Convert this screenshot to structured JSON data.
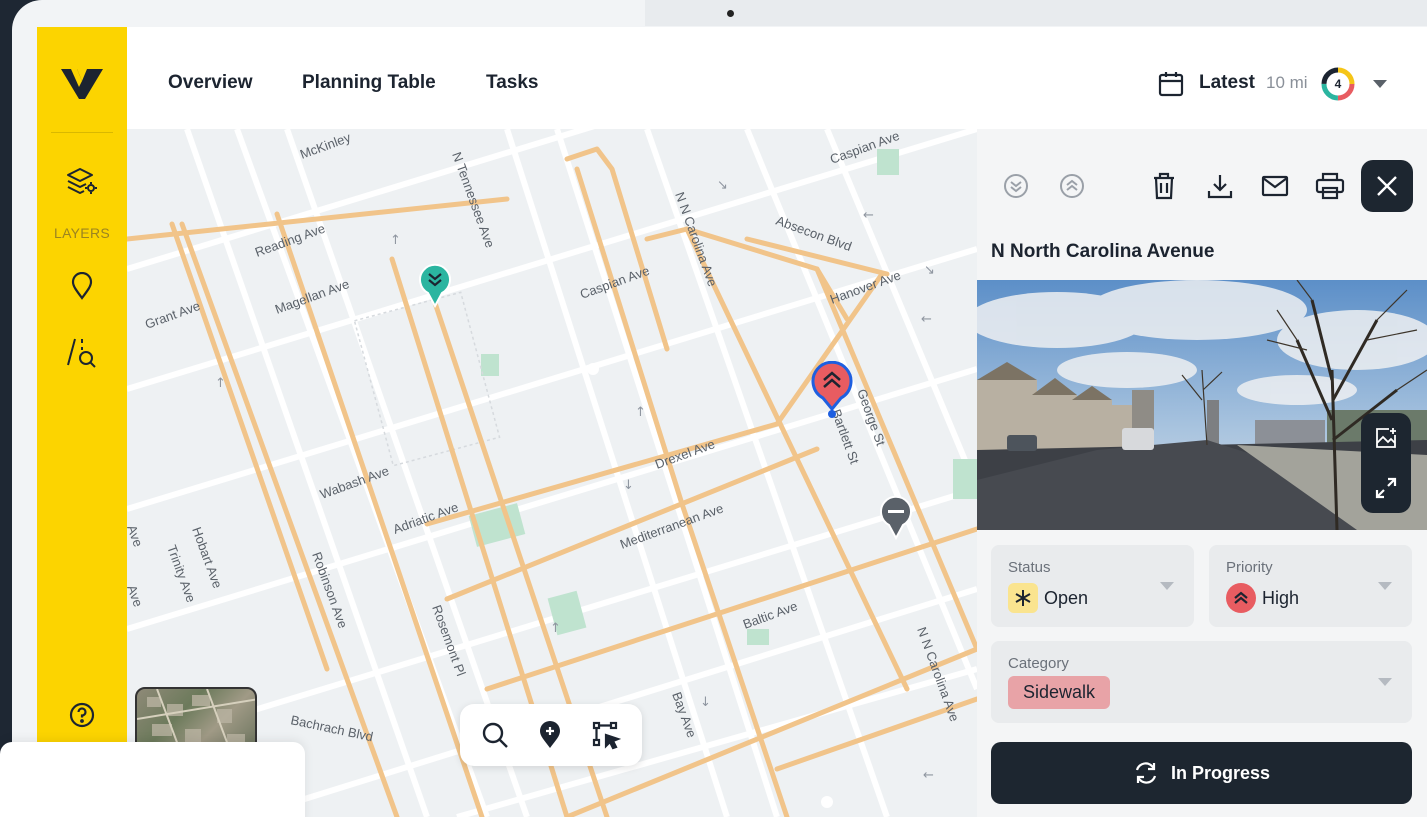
{
  "nav": {
    "tabs": [
      "Overview",
      "Planning Table",
      "Tasks"
    ],
    "date_filter": "Latest",
    "radius": "10 mi",
    "issue_count": "4"
  },
  "sidebar": {
    "layers_label": "LAYERS"
  },
  "map": {
    "street_labels": [
      "McKinley",
      "Reading Ave",
      "Magellan Ave",
      "Grant Ave",
      "N Tennessee Ave",
      "Caspian Ave",
      "Caspian Ave",
      "N N Carolina Ave",
      "Absecon Blvd",
      "Hanover Ave",
      "George St",
      "N Bartlett St",
      "Drexel Ave",
      "Mediterranean Ave",
      "Wabash Ave",
      "Adriatic Ave",
      "Hobart Ave",
      "Trinity Ave",
      "Robinson Ave",
      "Rosemont Pl",
      "Baltic Ave",
      "N N Carolina Ave",
      "Bachrach Blvd",
      "Bay Ave",
      "Ave",
      "Ave"
    ],
    "markers": [
      {
        "name": "low-priority",
        "color": "#2bb5a0"
      },
      {
        "name": "high-priority",
        "color": "#e85c61"
      },
      {
        "name": "none-priority",
        "color": "#5a6169"
      }
    ]
  },
  "panel": {
    "title": "N North Carolina Avenue",
    "status": {
      "label": "Status",
      "value": "Open"
    },
    "priority": {
      "label": "Priority",
      "value": "High"
    },
    "category": {
      "label": "Category",
      "value": "Sidewalk"
    },
    "action_label": "In Progress"
  },
  "colors": {
    "brand_yellow": "#fcd400",
    "dark": "#1d2630",
    "street": "#f1c48a",
    "priority_high": "#e85c61",
    "category_bg": "#e8a3a7"
  }
}
